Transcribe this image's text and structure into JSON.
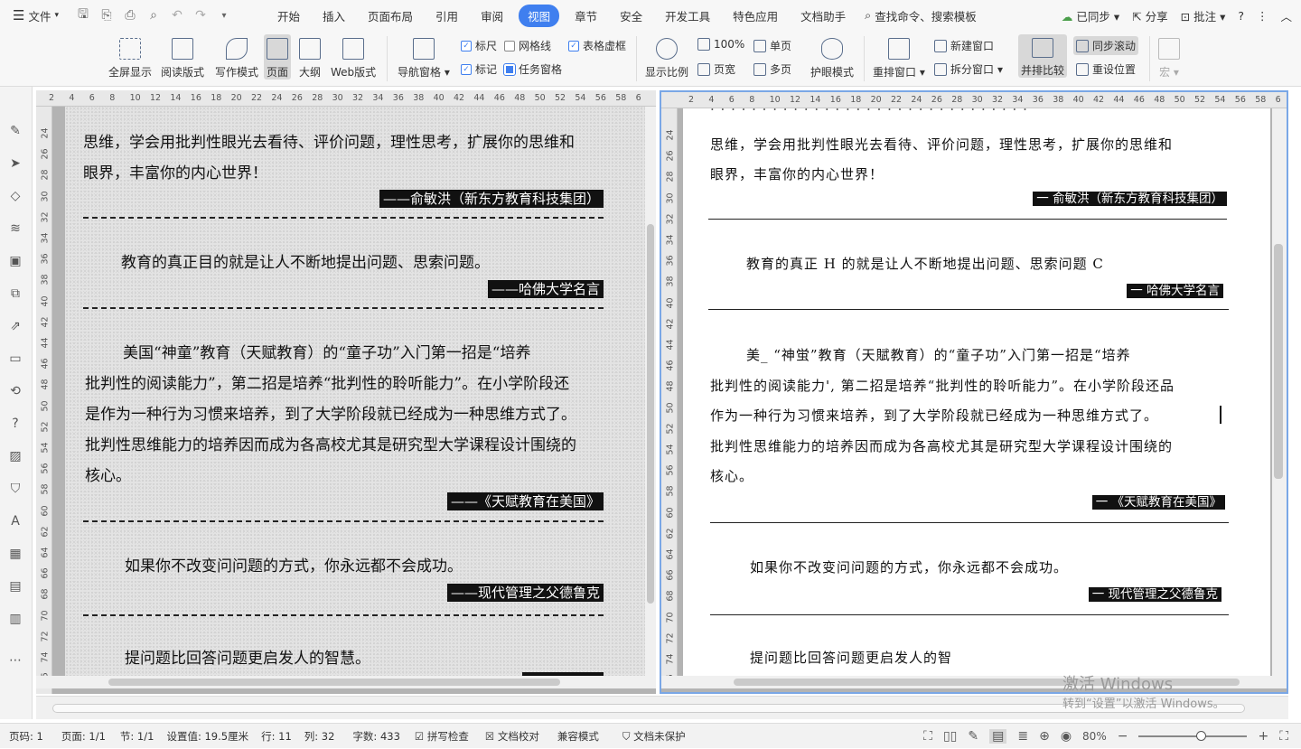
{
  "menubar": {
    "file_label": "文件",
    "tabs": [
      "开始",
      "插入",
      "页面布局",
      "引用",
      "审阅",
      "视图",
      "章节",
      "安全",
      "开发工具",
      "特色应用",
      "文档助手"
    ],
    "active_tab": "视图",
    "search_label": "查找命令、搜索模板",
    "sync_label": "已同步",
    "share_label": "分享",
    "comment_label": "批注"
  },
  "ribbon": {
    "fullscreen": "全屏显示",
    "reading": "阅读版式",
    "writing": "写作模式",
    "page": "页面",
    "outline": "大纲",
    "web": "Web版式",
    "ruler": "标尺",
    "gridlines": "网格线",
    "table_gridlines": "表格虚框",
    "nav_pane": "导航窗格",
    "markup": "标记",
    "task_pane": "任务窗格",
    "zoom_ratio": "显示比例",
    "zoom_100": "100%",
    "page_width": "页宽",
    "single_page": "单页",
    "multi_page": "多页",
    "eye_mode": "护眼模式",
    "rearrange": "重排窗口",
    "new_window": "新建窗口",
    "split_window": "拆分窗口",
    "side_by_side": "并排比较",
    "sync_scroll": "同步滚动",
    "reset_position": "重设位置",
    "macro": "宏"
  },
  "ruler_h_left": [
    "2",
    "4",
    "6",
    "8",
    "10",
    "12",
    "14",
    "16",
    "18",
    "20",
    "22",
    "24",
    "26",
    "28",
    "30",
    "32",
    "34",
    "36",
    "38",
    "40",
    "42",
    "44",
    "46",
    "48",
    "50",
    "52",
    "54",
    "56",
    "58",
    "6"
  ],
  "ruler_h_right": [
    "2",
    "4",
    "6",
    "8",
    "10",
    "12",
    "14",
    "16",
    "18",
    "20",
    "22",
    "24",
    "26",
    "28",
    "30",
    "32",
    "34",
    "36",
    "38",
    "40",
    "42",
    "44",
    "46",
    "48",
    "50",
    "52",
    "54",
    "56",
    "58",
    "6"
  ],
  "ruler_v": [
    "24",
    "26",
    "28",
    "30",
    "32",
    "34",
    "36",
    "38",
    "40",
    "42",
    "44",
    "46",
    "48",
    "50",
    "52",
    "54",
    "56",
    "58",
    "60",
    "62",
    "64",
    "66",
    "68",
    "70",
    "72",
    "74",
    "76"
  ],
  "left_doc": {
    "l1": "思维，学会用批判性眼光去看待、评价问题，理性思考，扩展你的思维和",
    "l2": "眼界，丰富你的内心世界！",
    "q1_src": "——俞敏洪（新东方教育科技集团）",
    "q2": "教育的真正目的就是让人不断地提出问题、思索问题。",
    "q2_src": "——哈佛大学名言",
    "p3_1": "美国“神童”教育（天赋教育）的“童子功”入门第一招是“培养",
    "p3_2": "批判性的阅读能力”，第二招是培养“批判性的聆听能力”。在小学阶段还",
    "p3_3": "是作为一种行为习惯来培养，到了大学阶段就已经成为一种思维方式了。",
    "p3_4": "批判性思维能力的培养因而成为各高校尤其是研究型大学课程设计围绕的",
    "p3_5": "核心。",
    "q3_src": "——《天赋教育在美国》",
    "q4": "如果你不改变问问题的方式，你永远都不会成功。",
    "q4_src": "——现代管理之父德鲁克",
    "q5": "提问题比回答问题更启发人的智慧。"
  },
  "right_doc": {
    "l1": "思维，学会用批判性眼光去看待、评价问题，理性思考，扩展你的思维和",
    "l2": "眼界，丰富你的内心世界！",
    "q1_src": "一  俞敏洪（新东方教育科技集团）",
    "q2": "教育的真正 H 的就是让人不断地提出问题、思索问题 C",
    "q2_src": "一  哈佛大学名言",
    "p3_1": "美_  “神蛍”教育（天賦教育）的“童子功”入门第一招是“培养",
    "p3_2": "批判性的阅读能力',  第二招是培养“批判性的聆听能力”。在小学阶段还品",
    "p3_3": "作为一种行为习惯来培养，到了大学阶段就已经成为一种思维方式了。",
    "p3_4": "批判性思维能力的培养因而成为各高校尤其是研究型大学课程设计围绕的",
    "p3_5": "核心。",
    "q3_src": "一  《天赋教育在美国》",
    "q4": "如果你不改变问问题的方式，你永远都不会成功。",
    "q4_src": "一  现代管理之父德鲁克",
    "q5": "提问题比回答问题更启发人的智"
  },
  "watermark": {
    "title": "激活 Windows",
    "subtitle": "转到“设置”以激活 Windows。"
  },
  "status": {
    "page_num": "页码: 1",
    "pages": "页面: 1/1",
    "section": "节: 1/1",
    "setting": "设置值: 19.5厘米",
    "row": "行: 11",
    "col": "列: 32",
    "words": "字数: 433",
    "spell": "拼写检查",
    "proof": "文档校对",
    "compat": "兼容模式",
    "protect": "文档未保护",
    "zoom": "80%"
  }
}
